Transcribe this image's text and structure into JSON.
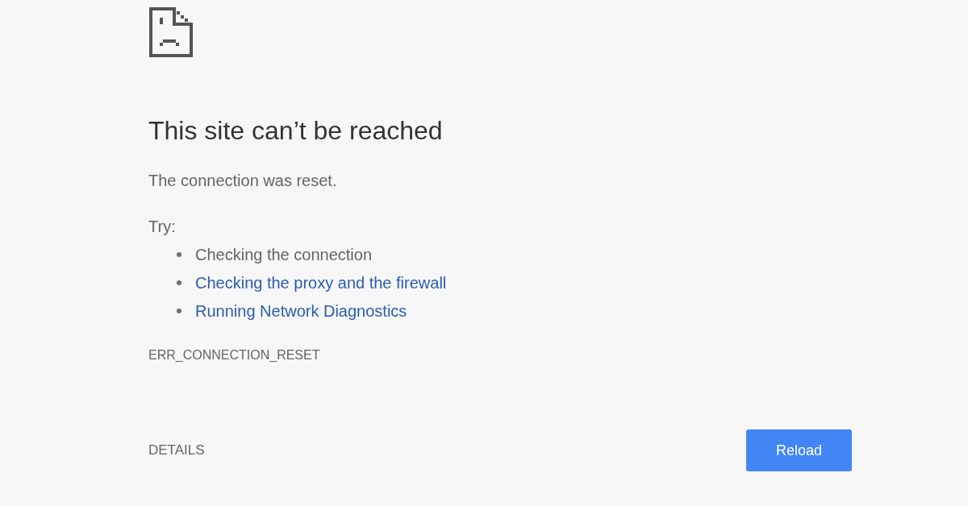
{
  "error_page": {
    "title": "This site can’t be reached",
    "message": "The connection was reset.",
    "suggestions_heading": "Try:",
    "suggestions": [
      {
        "kind": "text",
        "text": "Checking the connection"
      },
      {
        "kind": "link",
        "text": "Checking the proxy and the firewall"
      },
      {
        "kind": "link",
        "text": "Running Network Diagnostics"
      }
    ],
    "error_code": "ERR_CONNECTION_RESET",
    "details_button": "DETAILS",
    "reload_button": "Reload"
  }
}
